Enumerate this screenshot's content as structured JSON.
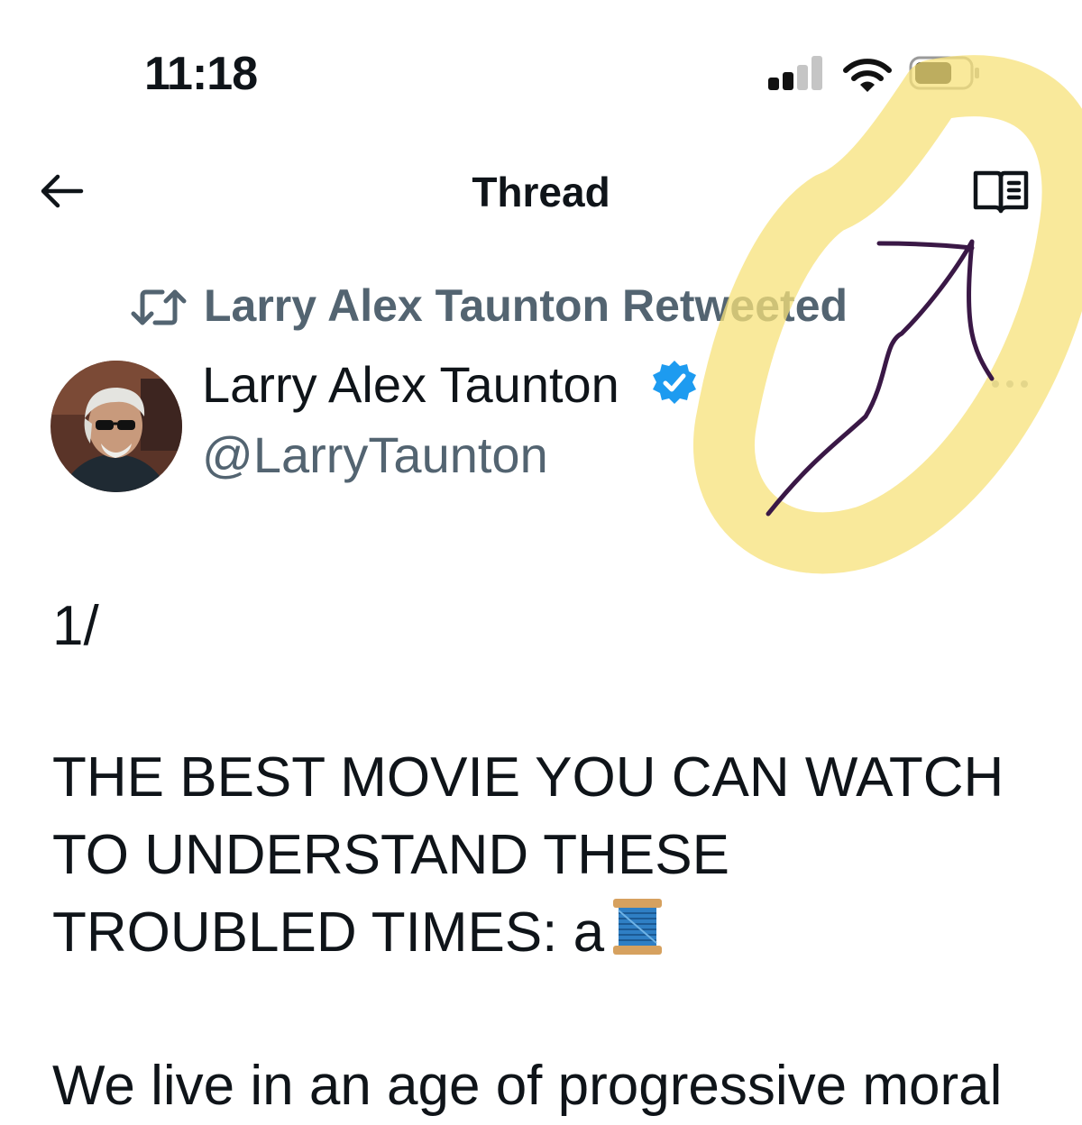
{
  "status_bar": {
    "time": "11:18",
    "signal_icon": "cellular-signal-icon",
    "wifi_icon": "wifi-icon",
    "battery_icon": "battery-icon"
  },
  "header": {
    "title": "Thread",
    "back_icon": "back-arrow-icon",
    "reader_icon": "reader-mode-icon"
  },
  "retweet_context": {
    "icon": "retweet-icon",
    "text": "Larry Alex Taunton Retweeted"
  },
  "tweet": {
    "author_name": "Larry Alex Taunton",
    "verified_icon": "verified-badge-icon",
    "handle": "@LarryTaunton",
    "more_icon": "more-options-icon",
    "thread_number": "1/",
    "lines": [
      "THE BEST MOVIE YOU CAN WATCH",
      "TO UNDERSTAND THESE",
      "TROUBLED TIMES: a"
    ],
    "emoji_icon": "spool-of-thread-icon",
    "next_line": "We live in an age of progressive moral"
  },
  "annotation": {
    "highlight_color": "#f7e27a",
    "arrow_color": "#3a1846"
  },
  "colors": {
    "text_primary": "#0f1419",
    "text_secondary": "#536471",
    "verified_blue": "#1d9bf0"
  }
}
